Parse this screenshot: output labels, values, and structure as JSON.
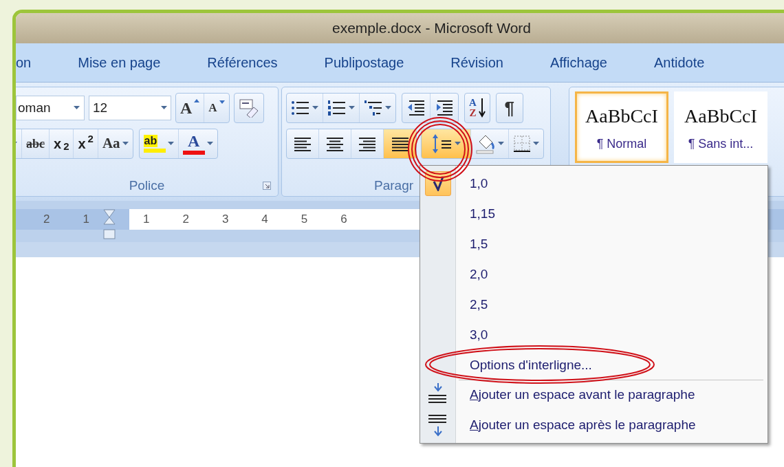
{
  "window": {
    "title": "exemple.docx - Microsoft Word"
  },
  "tabs": [
    {
      "label": "on",
      "selected": false
    },
    {
      "label": "Mise en page",
      "selected": false
    },
    {
      "label": "Références",
      "selected": false
    },
    {
      "label": "Publipostage",
      "selected": false
    },
    {
      "label": "Révision",
      "selected": false
    },
    {
      "label": "Affichage",
      "selected": false
    },
    {
      "label": "Antidote",
      "selected": false
    }
  ],
  "font_group": {
    "label": "Police",
    "font_name": "oman",
    "font_size": "12",
    "grow": "A",
    "shrink": "A",
    "strike": "abc",
    "subscript": "x$_{2}$",
    "superscript": "x$^{2}$",
    "change_case": "Aa",
    "highlight": "ab",
    "font_color": "A"
  },
  "paragraph_group": {
    "label": "Paragr",
    "sort_top": "A",
    "sort_bottom": "Z",
    "pilcrow": "¶",
    "align_buttons": [
      {
        "kind": "left",
        "selected": false
      },
      {
        "kind": "center",
        "selected": false
      },
      {
        "kind": "right",
        "selected": false
      },
      {
        "kind": "justify",
        "selected": true
      }
    ],
    "line_spacing_open": true
  },
  "styles": [
    {
      "sample": "AaBbCcI",
      "label": "¶ Normal",
      "selected": true
    },
    {
      "sample": "AaBbCcI",
      "label": "¶ Sans int...",
      "selected": false
    }
  ],
  "ruler": {
    "left_labels": [
      "2",
      "1"
    ],
    "right_labels": [
      "1",
      "2",
      "3",
      "4",
      "5",
      "6"
    ]
  },
  "line_spacing_menu": [
    {
      "kind": "spacing",
      "label": "1,0",
      "selected": true
    },
    {
      "kind": "spacing",
      "label": "1,15",
      "selected": false
    },
    {
      "kind": "spacing",
      "label": "1,5",
      "selected": false
    },
    {
      "kind": "spacing",
      "label": "2,0",
      "selected": false
    },
    {
      "kind": "spacing",
      "label": "2,5",
      "selected": false
    },
    {
      "kind": "spacing",
      "label": "3,0",
      "selected": false
    },
    {
      "kind": "command",
      "label": "Options d'interligne..."
    },
    {
      "kind": "space_before",
      "label": "Ajouter un espace avant le paragraphe",
      "mnemonic": true
    },
    {
      "kind": "space_after",
      "label": "Ajouter un espace après le paragraphe",
      "mnemonic": true
    }
  ]
}
